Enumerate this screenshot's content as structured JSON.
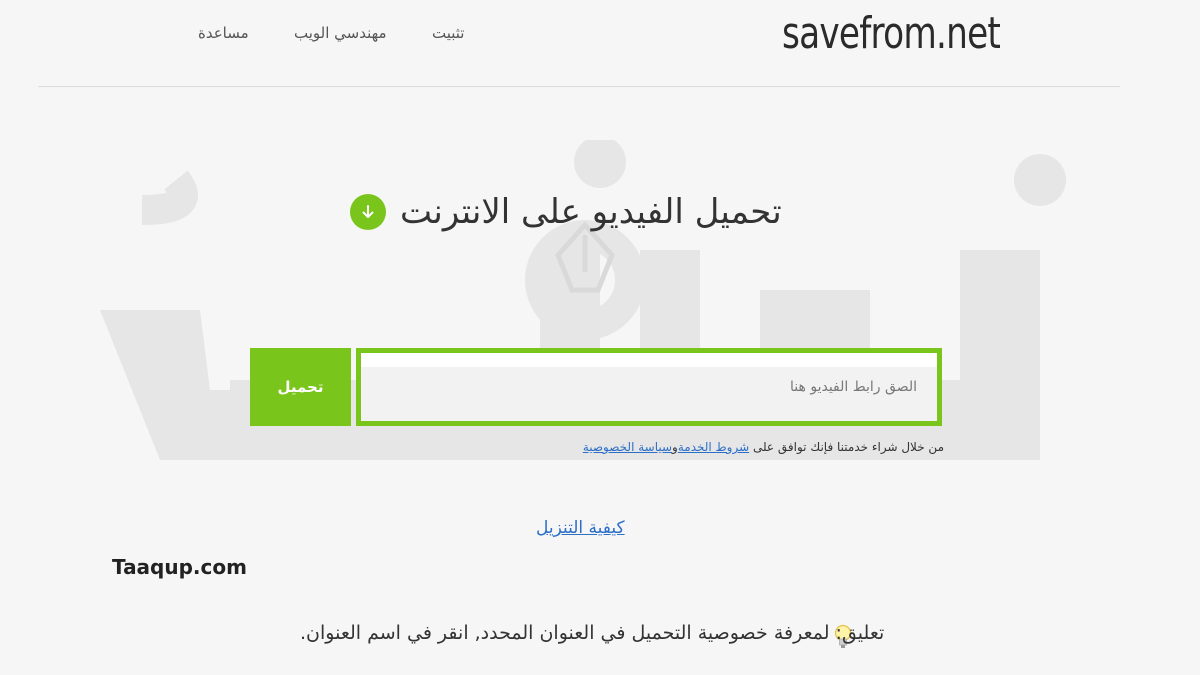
{
  "header": {
    "logo": "savefrom.net",
    "nav": {
      "install": "تثبيت",
      "webmasters": "مهندسي الويب",
      "help": "مساعدة"
    }
  },
  "main": {
    "title": "تحميل الفيديو على الانترنت",
    "download_button": "تحميل",
    "url_placeholder": "الصق رابط الفيديو هنا",
    "terms": {
      "prefix": "من خلال شراء خدمتنا فإنك توافق على",
      "terms_link": "شروط الخدمة",
      "joiner": "و",
      "privacy_link": "سياسة الخصوصية"
    },
    "howto_link": "كيفية التنزيل",
    "tip": "تعليق: لمعرفة خصوصية التحميل في العنوان المحدد, انقر في اسم العنوان."
  },
  "watermark": {
    "site": "Taaqup.com"
  },
  "colors": {
    "accent": "#7ac51c",
    "link": "#2c6fc7",
    "background": "#f6f6f6"
  },
  "icons": {
    "title_icon": "download-arrow-icon",
    "tip_icon": "lightbulb-icon"
  }
}
